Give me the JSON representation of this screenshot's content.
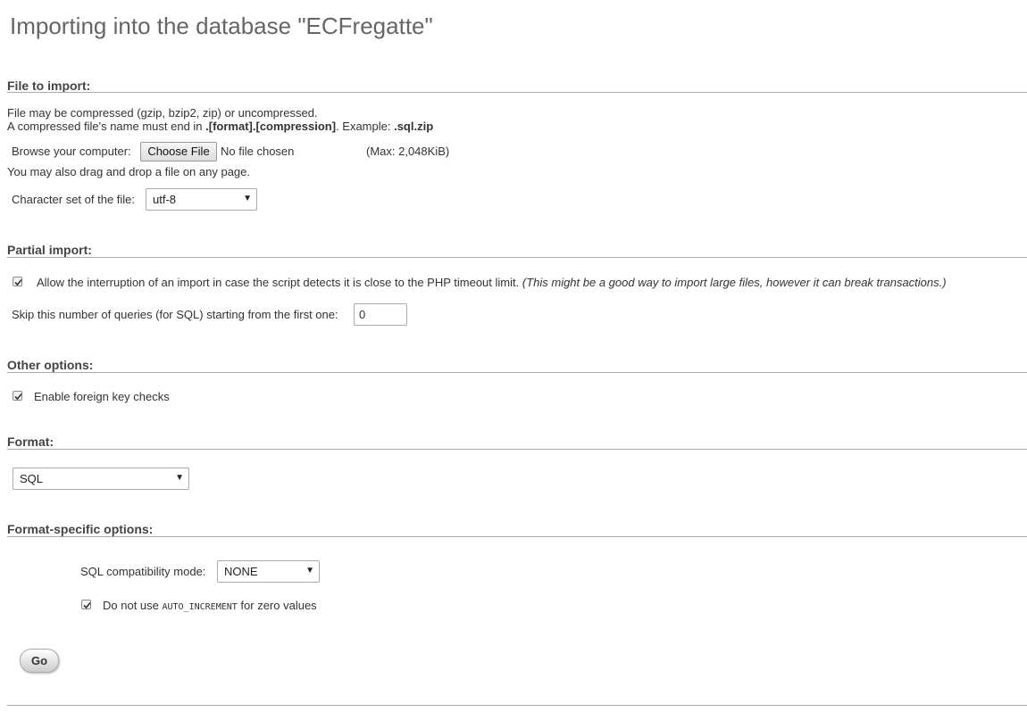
{
  "page": {
    "title": "Importing into the database \"ECFregatte\""
  },
  "file_section": {
    "heading": "File to import:",
    "compress_note": "File may be compressed (gzip, bzip2, zip) or uncompressed.",
    "name_note_prefix": "A compressed file's name must end in ",
    "name_note_format": ".[format].[compression]",
    "name_note_middle": ". Example: ",
    "name_note_example": ".sql.zip",
    "browse_label": "Browse your computer:",
    "choose_button": "Choose File",
    "no_file": "No file chosen",
    "max_size": "(Max: 2,048KiB)",
    "drag_note": "You may also drag and drop a file on any page.",
    "charset_label": "Character set of the file:",
    "charset_value": "utf-8"
  },
  "partial_section": {
    "heading": "Partial import:",
    "allow_interrupt_label": "Allow the interruption of an import in case the script detects it is close to the PHP timeout limit.",
    "allow_interrupt_note": "(This might be a good way to import large files, however it can break transactions.)",
    "allow_interrupt_checked": true,
    "skip_label": "Skip this number of queries (for SQL) starting from the first one:",
    "skip_value": "0"
  },
  "other_section": {
    "heading": "Other options:",
    "fk_label": "Enable foreign key checks",
    "fk_checked": true
  },
  "format_section": {
    "heading": "Format:",
    "format_value": "SQL"
  },
  "format_specific_section": {
    "heading": "Format-specific options:",
    "compat_label": "SQL compatibility mode:",
    "compat_value": "NONE",
    "no_auto_inc_prefix": "Do not use ",
    "no_auto_inc_code": "AUTO_INCREMENT",
    "no_auto_inc_suffix": " for zero values",
    "no_auto_inc_checked": true
  },
  "actions": {
    "go_label": "Go"
  },
  "icons": {
    "checkbox": "checkmark-icon",
    "dropdown": "dropdown-arrow-icon"
  }
}
